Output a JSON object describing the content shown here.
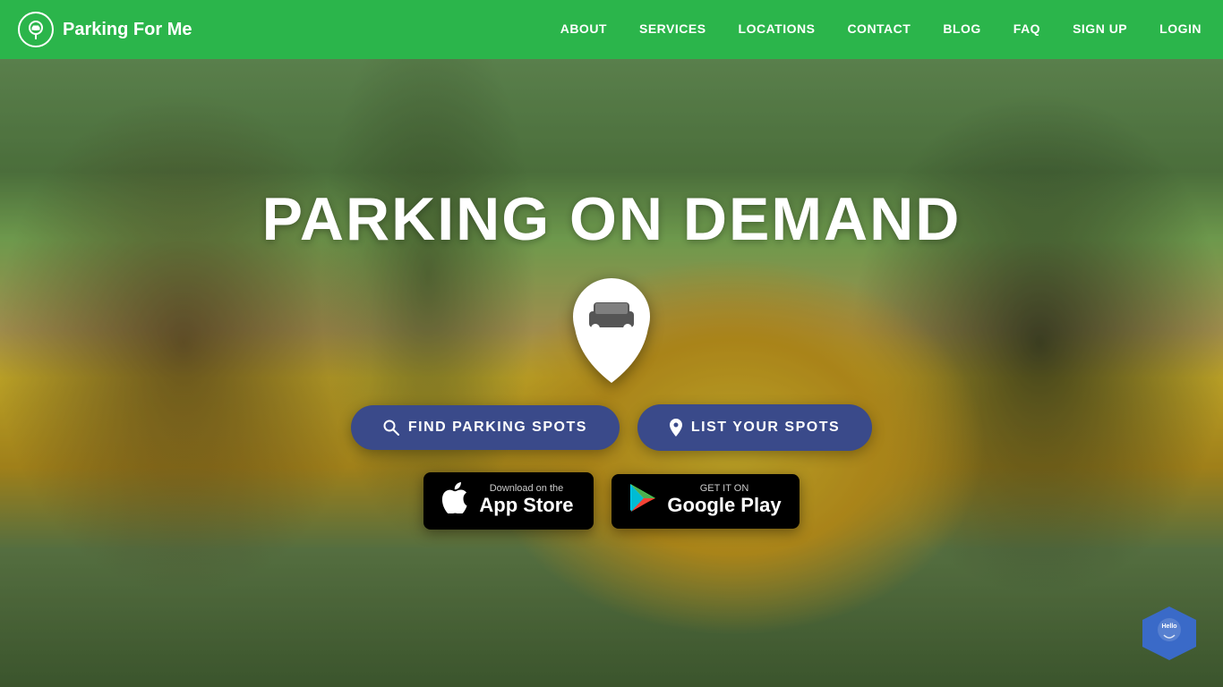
{
  "brand": {
    "name": "Parking For Me"
  },
  "nav": {
    "links": [
      {
        "label": "ABOUT",
        "id": "about"
      },
      {
        "label": "SERVICES",
        "id": "services"
      },
      {
        "label": "LOCATIONS",
        "id": "locations"
      },
      {
        "label": "CONTACT",
        "id": "contact"
      },
      {
        "label": "BLOG",
        "id": "blog"
      },
      {
        "label": "FAQ",
        "id": "faq"
      },
      {
        "label": "SIGN UP",
        "id": "signup"
      },
      {
        "label": "LOGIN",
        "id": "login"
      }
    ]
  },
  "hero": {
    "title": "PARKING ON DEMAND",
    "find_btn": "FIND PARKING SPOTS",
    "list_btn": "LIST YOUR SPOTS",
    "appstore": {
      "top_line": "Download on the",
      "main_line": "App Store"
    },
    "googleplay": {
      "top_line": "GET IT ON",
      "main_line": "Google Play"
    }
  },
  "widget": {
    "label": "Hello"
  }
}
